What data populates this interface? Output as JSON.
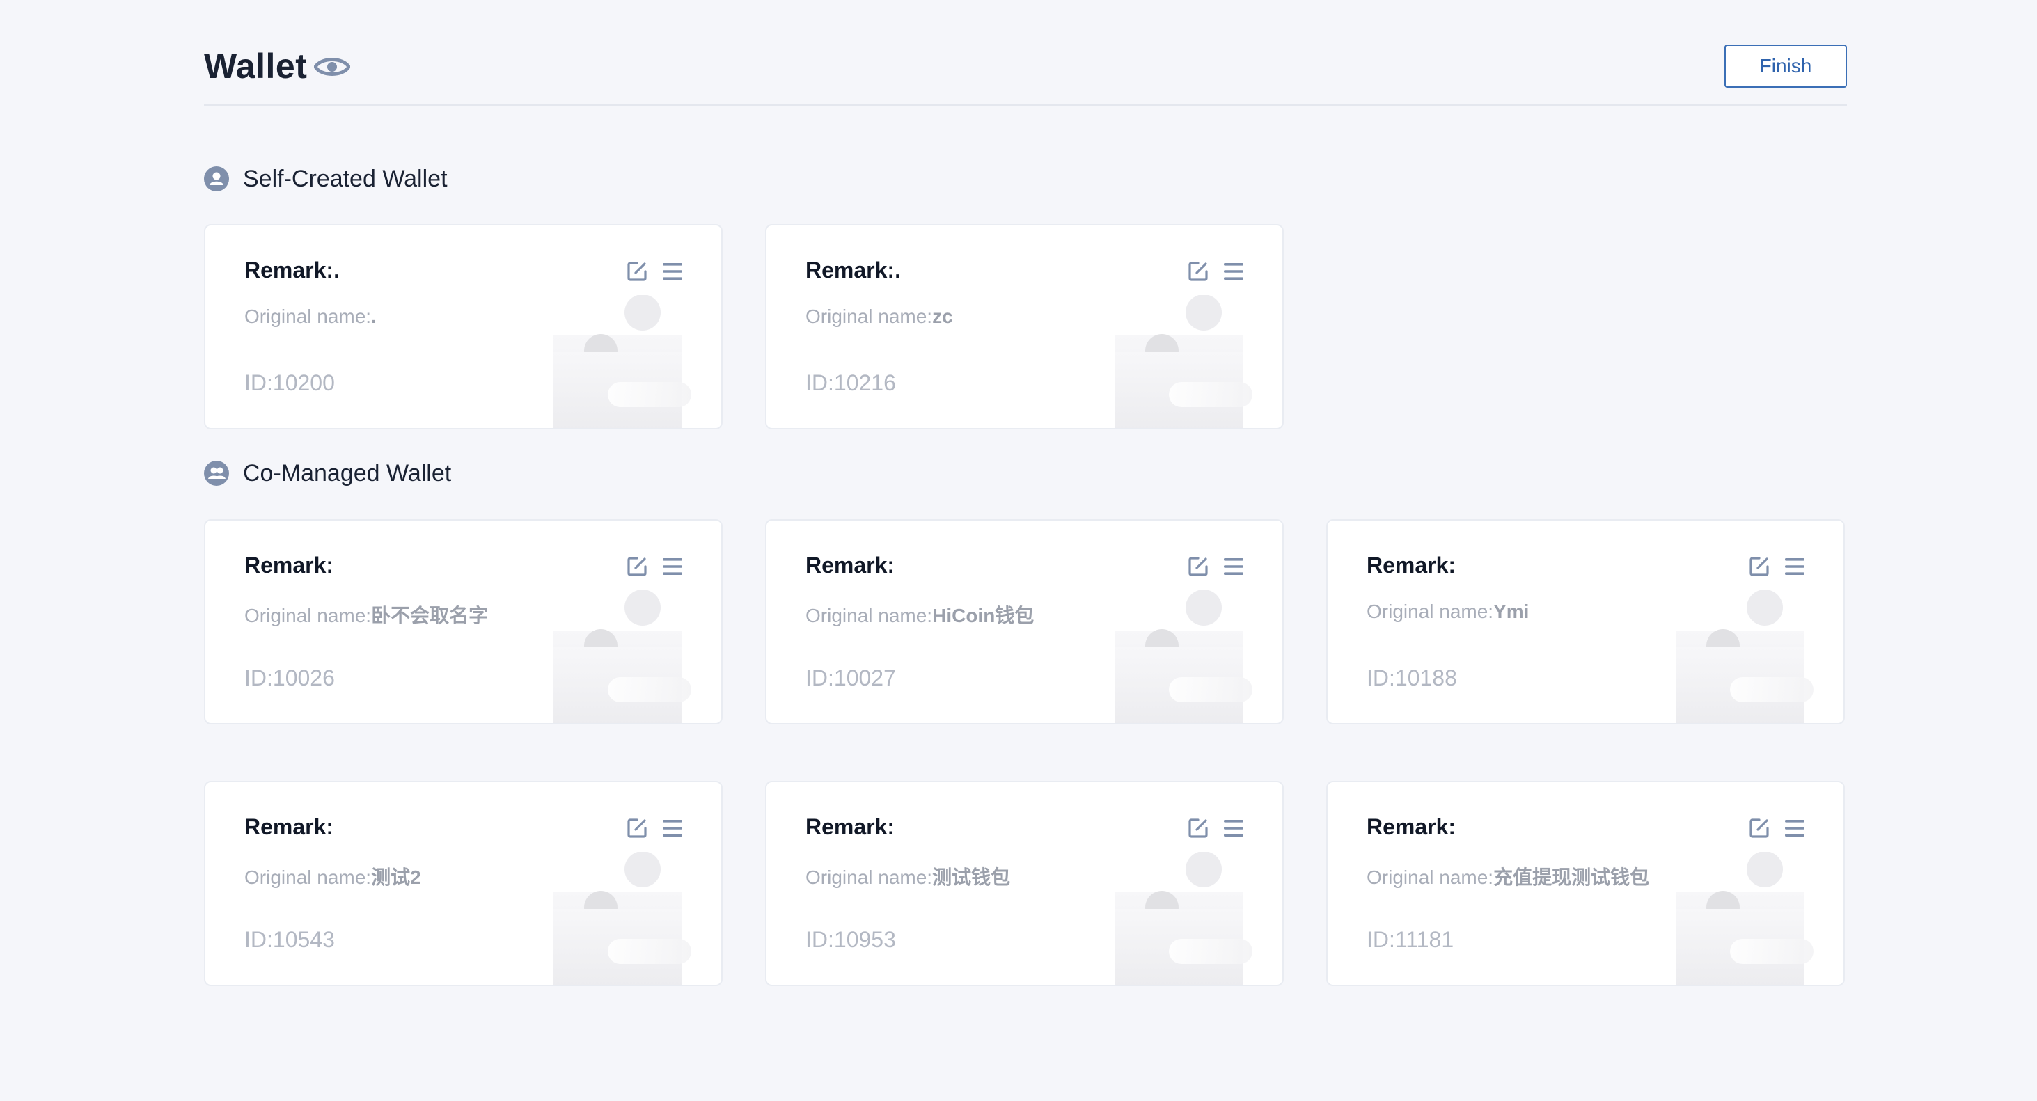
{
  "header": {
    "title": "Wallet",
    "finish_label": "Finish"
  },
  "sections": [
    {
      "title": "Self-Created Wallet",
      "wallets": [
        {
          "remark": "Remark:.",
          "orig_label": "Original name:",
          "orig_value": ".",
          "id": "ID:10200"
        },
        {
          "remark": "Remark:.",
          "orig_label": "Original name:",
          "orig_value": "zc",
          "id": "ID:10216"
        }
      ]
    },
    {
      "title": "Co-Managed Wallet",
      "wallets": [
        {
          "remark": "Remark:",
          "orig_label": "Original name:",
          "orig_value": "卧不会取名字",
          "id": "ID:10026"
        },
        {
          "remark": "Remark:",
          "orig_label": "Original name:",
          "orig_value": "HiCoin钱包",
          "id": "ID:10027"
        },
        {
          "remark": "Remark:",
          "orig_label": "Original name:",
          "orig_value": "Ymi",
          "id": "ID:10188"
        },
        {
          "remark": "Remark:",
          "orig_label": "Original name:",
          "orig_value": "测试2",
          "id": "ID:10543"
        },
        {
          "remark": "Remark:",
          "orig_label": "Original name:",
          "orig_value": "测试钱包",
          "id": "ID:10953"
        },
        {
          "remark": "Remark:",
          "orig_label": "Original name:",
          "orig_value": "充值提现测试钱包",
          "id": "ID:11181"
        }
      ]
    }
  ],
  "icons": {
    "title": "eye-icon",
    "self_section": "user-icon",
    "co_section": "users-icon",
    "card_edit": "edit-icon",
    "card_menu": "menu-icon"
  },
  "colors": {
    "background": "#f5f6fa",
    "card": "#ffffff",
    "accent": "#3b6fb6",
    "icon": "#7f8fab",
    "text_primary": "#1a2233",
    "text_muted": "#a8adb8"
  }
}
